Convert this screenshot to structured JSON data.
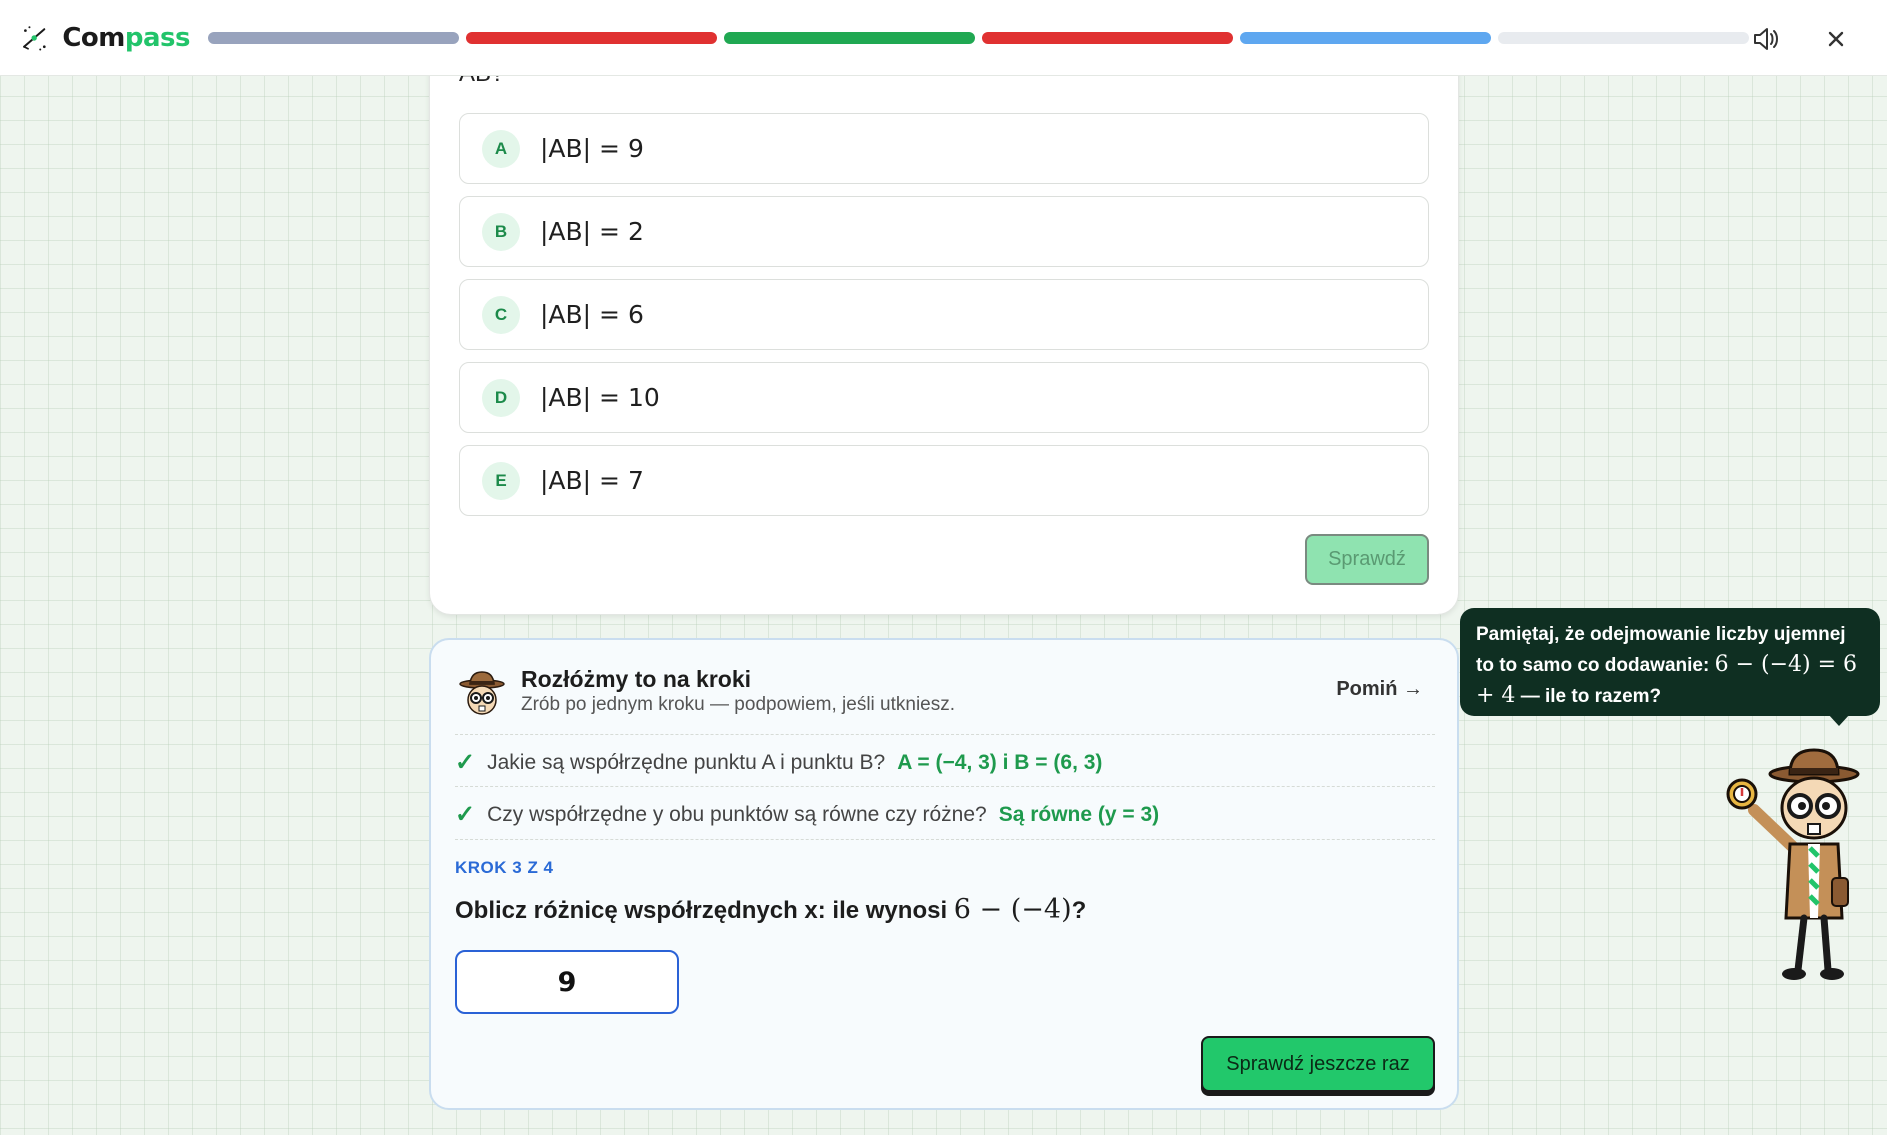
{
  "app": {
    "brand_left": "Com",
    "brand_right": "pass"
  },
  "progress": {
    "colors": [
      "#98a3bd",
      "#e03131",
      "#20a852",
      "#e03131",
      "#5ea7f0",
      "#e8ebef"
    ]
  },
  "question": {
    "prompt_tail": "AB?",
    "options": [
      {
        "letter": "A",
        "text": "|AB| = 9"
      },
      {
        "letter": "B",
        "text": "|AB| = 2"
      },
      {
        "letter": "C",
        "text": "|AB| = 6"
      },
      {
        "letter": "D",
        "text": "|AB| = 10"
      },
      {
        "letter": "E",
        "text": "|AB| = 7"
      }
    ],
    "check_label": "Sprawdź"
  },
  "steps": {
    "title": "Rozłóżmy to na kroki",
    "subtitle": "Zrób po jednym kroku — podpowiem, jeśli utkniesz.",
    "skip_label": "Pomiń →",
    "done": [
      {
        "question": "Jakie są współrzędne punktu A i punktu B?",
        "answer": "A = (−4, 3) i B = (6, 3)"
      },
      {
        "question": "Czy współrzędne y obu punktów są równe czy różne?",
        "answer": "Są równe (y = 3)"
      }
    ],
    "current_label": "KROK 3 Z 4",
    "current_question_prefix": "Oblicz różnicę współrzędnych x: ile wynosi",
    "current_question_math": "6 − (−4)",
    "current_question_suffix": "?",
    "input_value": "9",
    "submit_label": "Sprawdź jeszcze raz"
  },
  "hint": {
    "text_1": "Pamiętaj, że odejmowanie liczby ujemnej to to samo co dodawanie:",
    "math": "6 − (−4) = 6 + 4",
    "text_2": "— ile to razem?"
  }
}
